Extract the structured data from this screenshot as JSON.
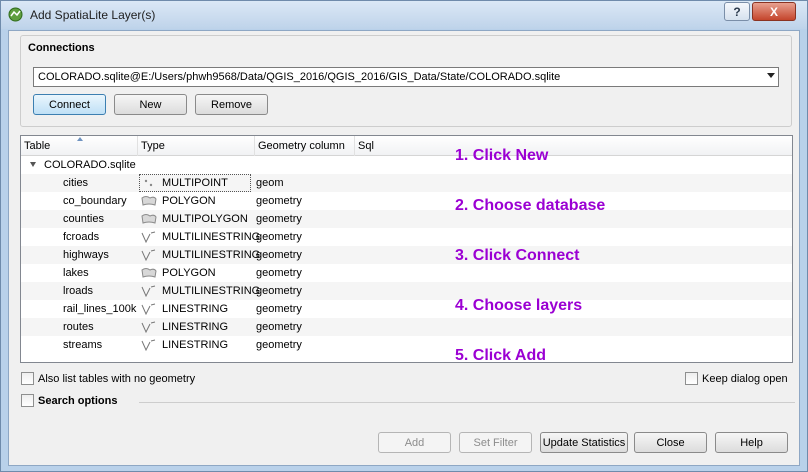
{
  "window": {
    "title": "Add SpatiaLite Layer(s)",
    "help_button": "?",
    "close_button": "X"
  },
  "connections": {
    "group_title": "Connections",
    "selected": "COLORADO.sqlite@E:/Users/phwh9568/Data/QGIS_2016/QGIS_2016/GIS_Data/State/COLORADO.sqlite",
    "connect_label": "Connect",
    "new_label": "New",
    "remove_label": "Remove"
  },
  "table": {
    "headers": [
      "Table",
      "Type",
      "Geometry column",
      "Sql"
    ],
    "database": "COLORADO.sqlite",
    "rows": [
      {
        "name": "cities",
        "type": "MULTIPOINT",
        "icon": "point-geometry-icon",
        "geom": "geom"
      },
      {
        "name": "co_boundary",
        "type": "POLYGON",
        "icon": "polygon-geometry-icon",
        "geom": "geometry"
      },
      {
        "name": "counties",
        "type": "MULTIPOLYGON",
        "icon": "polygon-geometry-icon",
        "geom": "geometry"
      },
      {
        "name": "fcroads",
        "type": "MULTILINESTRING",
        "icon": "line-geometry-icon",
        "geom": "geometry"
      },
      {
        "name": "highways",
        "type": "MULTILINESTRING",
        "icon": "line-geometry-icon",
        "geom": "geometry"
      },
      {
        "name": "lakes",
        "type": "POLYGON",
        "icon": "polygon-geometry-icon",
        "geom": "geometry"
      },
      {
        "name": "lroads",
        "type": "MULTILINESTRING",
        "icon": "line-geometry-icon",
        "geom": "geometry"
      },
      {
        "name": "rail_lines_100k",
        "type": "LINESTRING",
        "icon": "line-geometry-icon",
        "geom": "geometry"
      },
      {
        "name": "routes",
        "type": "LINESTRING",
        "icon": "line-geometry-icon",
        "geom": "geometry"
      },
      {
        "name": "streams",
        "type": "LINESTRING",
        "icon": "line-geometry-icon",
        "geom": "geometry"
      }
    ]
  },
  "annotations": [
    "1. Click New",
    "2. Choose database",
    "3. Click Connect",
    "4. Choose layers",
    "5. Click Add"
  ],
  "options": {
    "list_no_geometry": "Also list tables with no geometry",
    "keep_open": "Keep dialog open",
    "search_options": "Search options"
  },
  "footer": {
    "add": "Add",
    "set_filter": "Set Filter",
    "update_statistics": "Update Statistics",
    "close": "Close",
    "help": "Help"
  },
  "colors": {
    "annotation": "#9b00d3",
    "title_bar": "#bed3ea"
  }
}
